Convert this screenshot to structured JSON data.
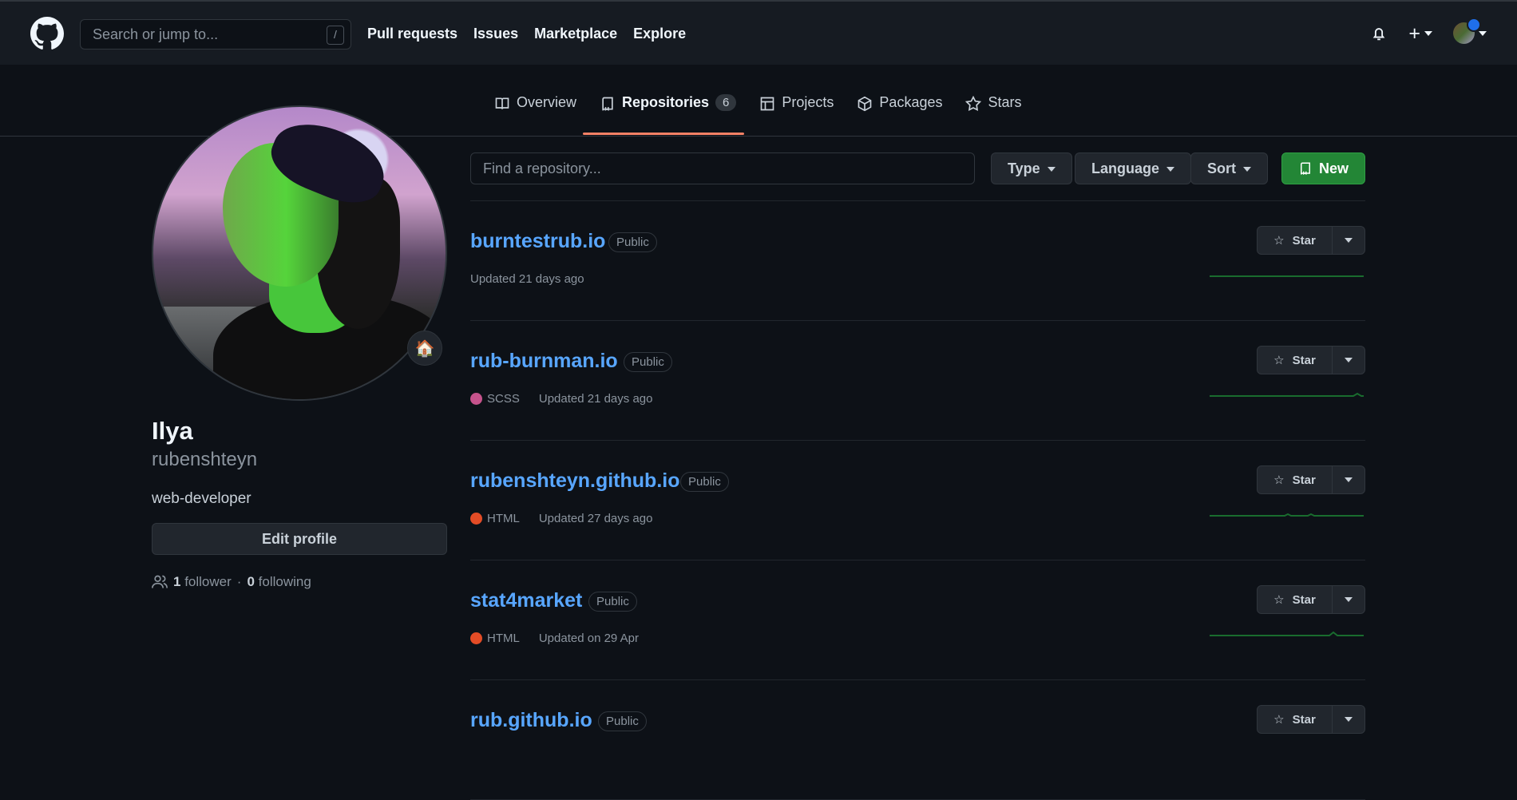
{
  "header": {
    "search_placeholder": "Search or jump to...",
    "shortcut": "/",
    "nav": [
      "Pull requests",
      "Issues",
      "Marketplace",
      "Explore"
    ]
  },
  "profile": {
    "name": "Ilya",
    "login": "rubenshteyn",
    "bio": "web-developer",
    "edit_label": "Edit profile",
    "followers_count": "1",
    "followers_label": "follower",
    "separator": "·",
    "following_count": "0",
    "following_label": "following",
    "status_icon": "🏠"
  },
  "tabs": [
    {
      "label": "Overview"
    },
    {
      "label": "Repositories",
      "count": "6"
    },
    {
      "label": "Projects"
    },
    {
      "label": "Packages"
    },
    {
      "label": "Stars"
    }
  ],
  "repos": {
    "search_placeholder": "Find a repository...",
    "filters": [
      "Type",
      "Language",
      "Sort"
    ],
    "new_label": "New",
    "items": [
      {
        "name": "burntestrub.io",
        "visibility": "Public",
        "language": "",
        "language_color": "",
        "updated": "Updated 21 days ago",
        "star_label": "Star"
      },
      {
        "name": "rub-burnman.io",
        "visibility": "Public",
        "language": "SCSS",
        "language_color": "#c6538c",
        "updated": "Updated 21 days ago",
        "star_label": "Star"
      },
      {
        "name": "rubenshteyn.github.io",
        "visibility": "Public",
        "language": "HTML",
        "language_color": "#e34c26",
        "updated": "Updated 27 days ago",
        "star_label": "Star"
      },
      {
        "name": "stat4market",
        "visibility": "Public",
        "language": "HTML",
        "language_color": "#e34c26",
        "updated": "Updated on 29 Apr",
        "star_label": "Star"
      },
      {
        "name": "rub.github.io",
        "visibility": "Public",
        "language": "",
        "language_color": "",
        "updated": "",
        "star_label": "Star"
      }
    ]
  },
  "colors": {
    "background": "#0d1117",
    "header": "#161b22",
    "accent": "#f78166",
    "link": "#58a6ff",
    "primary": "#238636"
  }
}
